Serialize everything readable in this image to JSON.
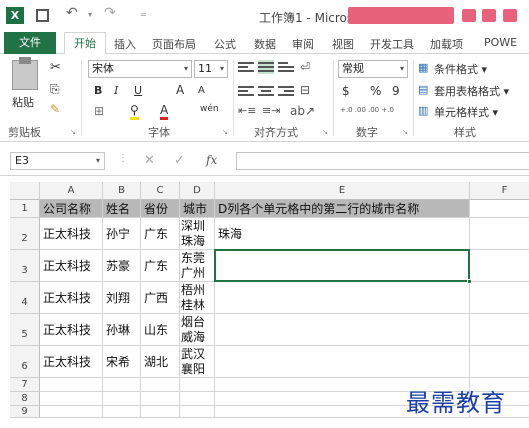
{
  "titlebar": {
    "app_icon": "X",
    "title": "工作簿1 - Micros"
  },
  "tabs": [
    "文件",
    "开始",
    "插入",
    "页面布局",
    "公式",
    "数据",
    "审阅",
    "视图",
    "开发工具",
    "加载项",
    "POWE"
  ],
  "ribbon": {
    "clipboard": {
      "paste_label": "粘贴",
      "group_label": "剪贴板"
    },
    "font": {
      "font_name": "宋体",
      "font_size": "11",
      "bold": "B",
      "italic": "I",
      "underline": "U",
      "grow": "A",
      "shrink": "A",
      "font_color": "A",
      "phonetic": "wén",
      "group_label": "字体"
    },
    "alignment": {
      "group_label": "对齐方式"
    },
    "number": {
      "format": "常规",
      "currency": "$",
      "percent": "%",
      "comma": "9",
      "inc_dec": "+.0 .00",
      "dec_dec": ".00 +.0",
      "group_label": "数字"
    },
    "styles": {
      "conditional": "条件格式",
      "table": "套用表格格式",
      "cell_styles": "单元格样式",
      "group_label": "样式"
    }
  },
  "formula_bar": {
    "name_box": "E3",
    "fx": "fx",
    "formula": ""
  },
  "columns": [
    "A",
    "B",
    "C",
    "D",
    "E",
    "F"
  ],
  "rows": [
    {
      "num": "1",
      "cells": [
        "公司名称",
        "姓名",
        "省份",
        "城市",
        "D列各个单元格中的第二行的城市名称"
      ]
    },
    {
      "num": "2",
      "cells": [
        "正太科技",
        "孙宁",
        "广东",
        "深圳\n珠海",
        "珠海"
      ]
    },
    {
      "num": "3",
      "cells": [
        "正太科技",
        "苏豪",
        "广东",
        "东莞\n广州",
        ""
      ]
    },
    {
      "num": "4",
      "cells": [
        "正太科技",
        "刘翔",
        "广西",
        "梧州\n桂林",
        ""
      ]
    },
    {
      "num": "5",
      "cells": [
        "正太科技",
        "孙琳",
        "山东",
        "烟台\n威海",
        ""
      ]
    },
    {
      "num": "6",
      "cells": [
        "正太科技",
        "宋希",
        "湖北",
        "武汉\n襄阳",
        ""
      ]
    },
    {
      "num": "7",
      "cells": [
        "",
        "",
        "",
        "",
        ""
      ]
    },
    {
      "num": "8",
      "cells": [
        "",
        "",
        "",
        "",
        ""
      ]
    },
    {
      "num": "9",
      "cells": [
        "",
        "",
        "",
        "",
        ""
      ]
    }
  ],
  "watermark": "最需教育",
  "colors": {
    "excel_green": "#217346",
    "header_fill": "#b8b8b8",
    "redaction": "#e8627c",
    "watermark": "#1b3ea8"
  }
}
